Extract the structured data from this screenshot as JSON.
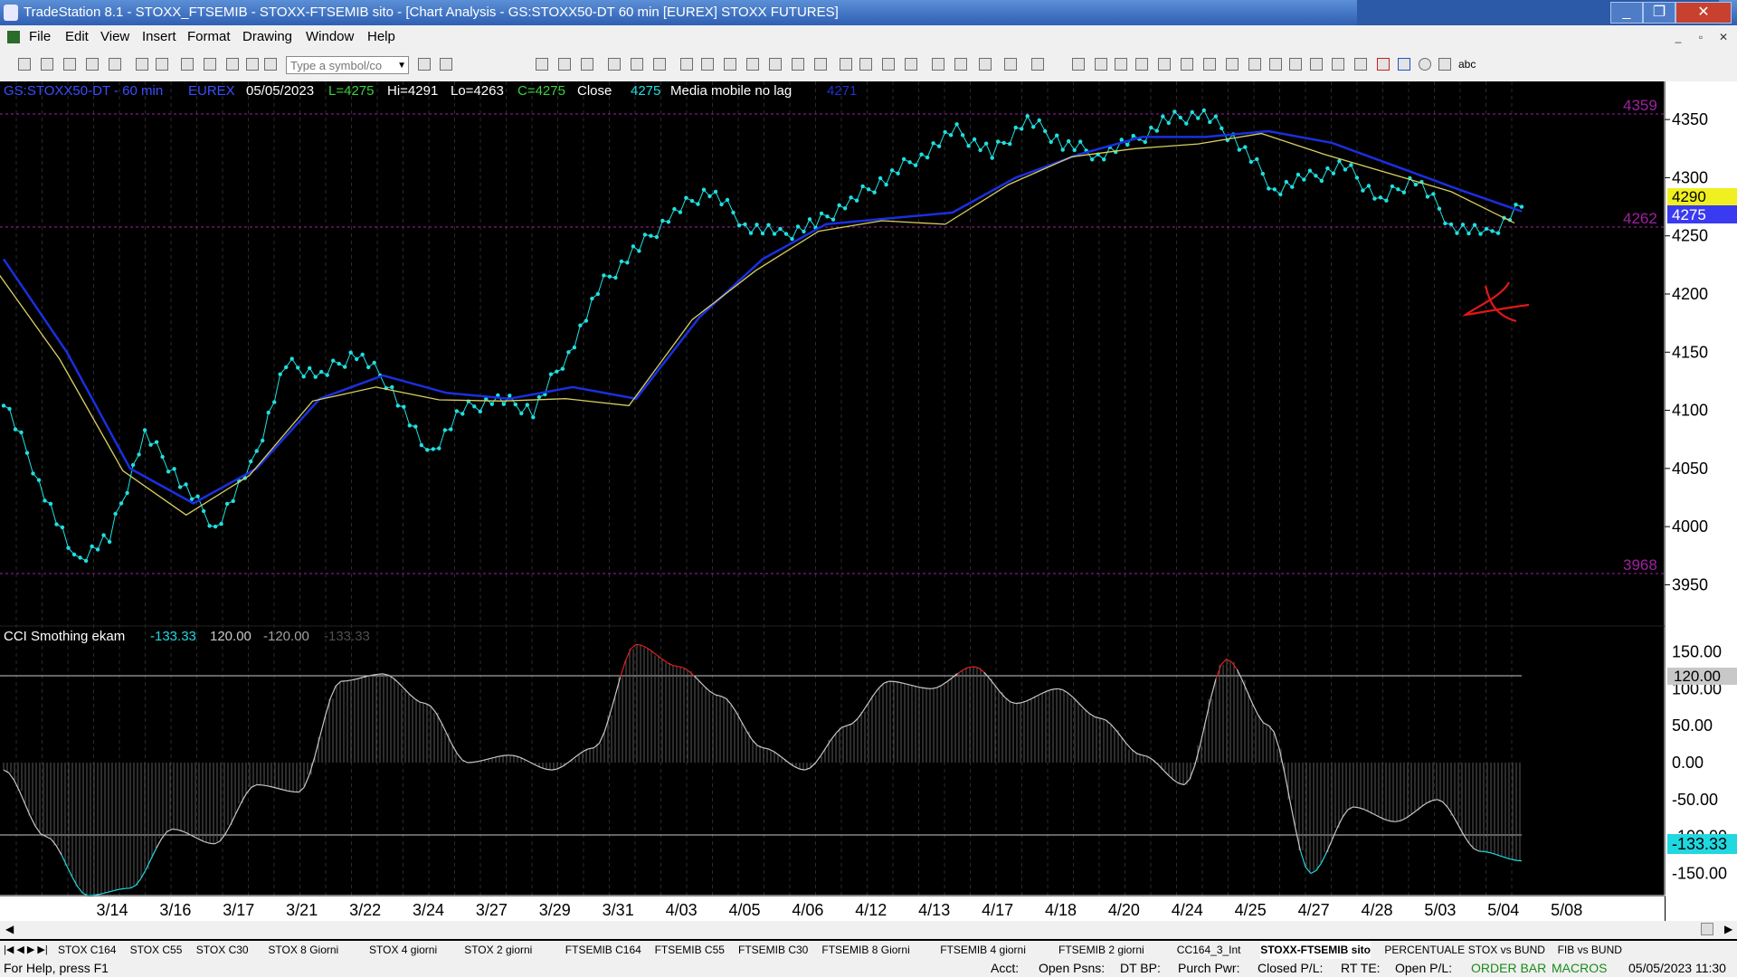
{
  "window": {
    "title": "TradeStation 8.1 - STOXX_FTSEMIB - STOXX-FTSEMIB sito - [Chart Analysis - GS:STOXX50-DT  60 min  [EUREX] STOXX FUTURES]",
    "controls": [
      "_",
      "❐",
      "✕"
    ]
  },
  "menu": {
    "items": [
      "File",
      "Edit",
      "View",
      "Insert",
      "Format",
      "Drawing",
      "Window",
      "Help"
    ]
  },
  "toolbar": {
    "symbol_placeholder": "Type a symbol/co",
    "text_tool": "abc"
  },
  "chart_header": {
    "symbol": "GS:STOXX50-DT - 60 min",
    "exchange": "EUREX",
    "date": "05/05/2023",
    "last": "L=4275",
    "high": "Hi=4291",
    "low": "Lo=4263",
    "close": "C=4275",
    "close_label": "Close",
    "close_value": "4275",
    "indicator_name": "Media mobile no lag",
    "indicator_value": "4271"
  },
  "price_axis": {
    "ticks": [
      "4350",
      "4300",
      "4250",
      "4200",
      "4150",
      "4100",
      "4050",
      "4000",
      "3950"
    ],
    "markers": {
      "top": "4359",
      "mid": "4262",
      "bottom": "3968"
    },
    "yellow_tag": "4290",
    "blue_tag": "4275"
  },
  "cci_panel": {
    "name": "CCI Smothing ekam",
    "value": "-133.33",
    "upper": "120.00",
    "lower": "-120.00",
    "value2": "-133.33",
    "ticks": [
      "150.00",
      "100.00",
      "50.00",
      "0.00",
      "-50.00",
      "-100.00",
      "-150.00"
    ],
    "upper_tag": "120.00",
    "value_tag": "-133.33"
  },
  "date_axis": [
    "3/14",
    "3/16",
    "3/17",
    "3/21",
    "3/22",
    "3/24",
    "3/27",
    "3/29",
    "3/31",
    "4/03",
    "4/05",
    "4/06",
    "4/12",
    "4/13",
    "4/17",
    "4/18",
    "4/20",
    "4/24",
    "4/25",
    "4/27",
    "4/28",
    "5/03",
    "5/04",
    "5/08"
  ],
  "tabs": [
    "STOX C164",
    "STOX C55",
    "STOX  C30",
    "STOX  8 Giorni",
    "STOX 4 giorni",
    "STOX  2 giorni",
    "FTSEMIB C164",
    "FTSEMIB C55",
    "FTSEMIB C30",
    "FTSEMIB  8 Giorni",
    "FTSEMIB  4 giorni",
    "FTSEMIB  2 giorni",
    "CC164_3_Int",
    "STOXX-FTSEMIB sito",
    "PERCENTUALE",
    "STOX vs BUND",
    "FIB vs BUND"
  ],
  "active_tab": "STOXX-FTSEMIB sito",
  "status": {
    "help": "For Help, press F1",
    "acct": "Acct:",
    "open_psns": "Open Psns:",
    "dt_bp": "DT BP:",
    "purch_pwr": "Purch Pwr:",
    "closed_pl": "Closed P/L:",
    "rt_te": "RT TE:",
    "open_pl": "Open P/L:",
    "order_bar": "ORDER BAR",
    "macros": "MACROS",
    "datetime": "05/05/2023 11:30"
  },
  "colors": {
    "price_dots": "#20e0e0",
    "blue_ma": "#1a2fe0",
    "yellow_ma": "#d8d060",
    "cci_line": "#c8c8c8",
    "cci_over": "#e02020",
    "cci_under": "#20d8e0",
    "marker": "#a020a0",
    "annotation": "#e01818"
  },
  "chart_data": [
    {
      "type": "line",
      "title": "GS:STOXX50-DT - 60 min",
      "ylim": [
        3920,
        4375
      ],
      "x_categories": [
        "3/14",
        "3/16",
        "3/17",
        "3/21",
        "3/22",
        "3/24",
        "3/27",
        "3/29",
        "3/31",
        "4/03",
        "4/05",
        "4/06",
        "4/12",
        "4/13",
        "4/17",
        "4/18",
        "4/20",
        "4/24",
        "4/25",
        "4/27",
        "4/28",
        "5/03",
        "5/04"
      ],
      "series": [
        {
          "name": "Close",
          "values": [
            4110,
            4040,
            3970,
            3990,
            4080,
            4040,
            4000,
            4050,
            4140,
            4130,
            4150,
            4120,
            4060,
            4100,
            4110,
            4100,
            4150,
            4210,
            4240,
            4270,
            4290,
            4260,
            4250,
            4260,
            4280,
            4300,
            4320,
            4340,
            4320,
            4350,
            4330,
            4320,
            4330,
            4350,
            4355,
            4330,
            4290,
            4300,
            4310,
            4280,
            4300,
            4260,
            4250,
            4275
          ]
        },
        {
          "name": "Media mobile no lag",
          "values": [
            4230,
            4150,
            4050,
            4020,
            4050,
            4110,
            4130,
            4115,
            4110,
            4120,
            4110,
            4180,
            4230,
            4260,
            4265,
            4270,
            4300,
            4320,
            4335,
            4335,
            4340,
            4330,
            4310,
            4290,
            4271
          ]
        }
      ]
    },
    {
      "type": "area",
      "title": "CCI Smothing ekam",
      "ylim": [
        -180,
        175
      ],
      "levels": [
        120,
        -120
      ],
      "values": [
        -10,
        -100,
        -180,
        -170,
        -90,
        -110,
        -30,
        -40,
        110,
        120,
        80,
        0,
        10,
        -10,
        20,
        160,
        130,
        90,
        20,
        -10,
        50,
        110,
        100,
        130,
        80,
        100,
        60,
        10,
        -30,
        140,
        50,
        -150,
        -60,
        -80,
        -50,
        -120,
        -133
      ]
    }
  ]
}
